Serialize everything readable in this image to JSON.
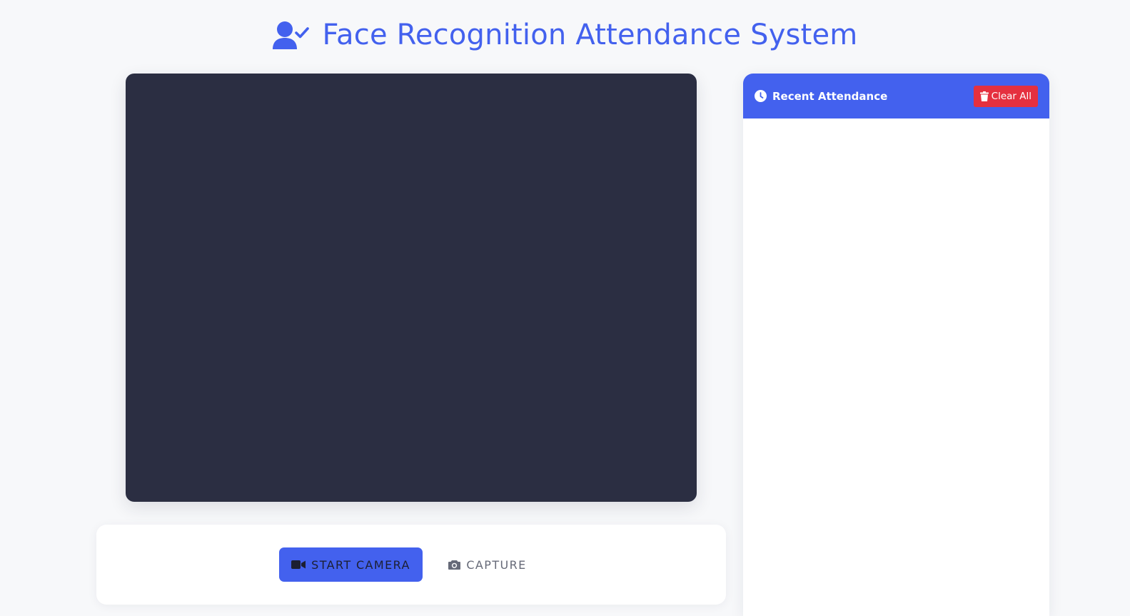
{
  "header": {
    "title": "Face Recognition Attendance System",
    "icon": "user-check-icon"
  },
  "camera": {
    "start_label": "START CAMERA",
    "start_icon": "video-camera-icon",
    "capture_label": "CAPTURE",
    "capture_icon": "camera-icon"
  },
  "attendance_panel": {
    "title": "Recent Attendance",
    "title_icon": "clock-icon",
    "clear_label": "Clear All",
    "clear_icon": "trash-icon",
    "records": []
  },
  "colors": {
    "primary": "#4361ee",
    "danger": "#e5303f",
    "video_background": "#2b2e42",
    "page_background": "#f7f8fa"
  }
}
